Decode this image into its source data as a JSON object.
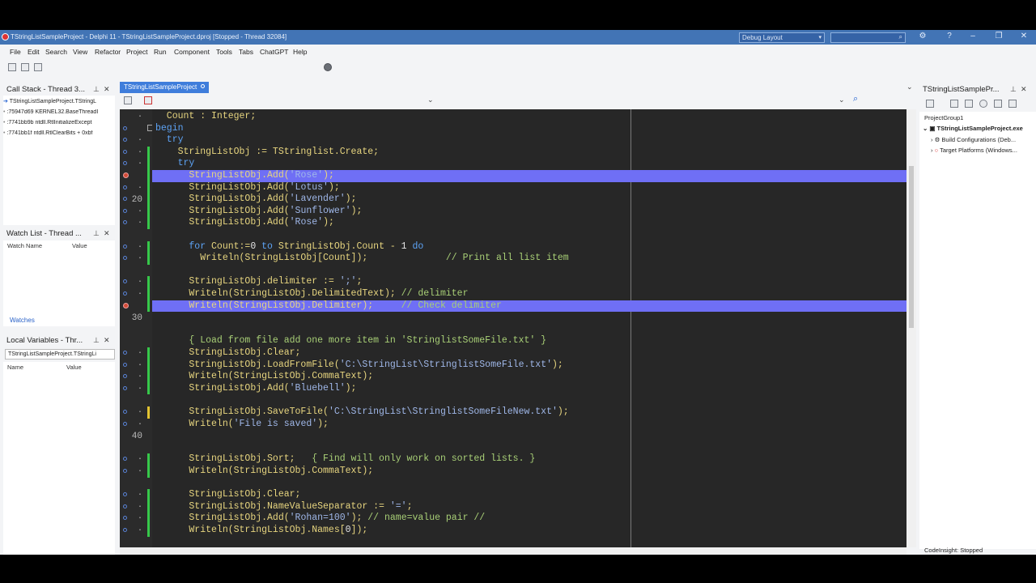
{
  "window": {
    "title": "TStringListSampleProject - Delphi 11 - TStringListSampleProject.dproj [Stopped - Thread 32084]",
    "layout": "Debug Layout"
  },
  "menu": [
    "File",
    "Edit",
    "Search",
    "View",
    "Refactor",
    "Project",
    "Run",
    "Component",
    "Tools",
    "Tabs",
    "ChatGPT",
    "Help"
  ],
  "call_stack": {
    "title": "Call Stack - Thread 3...",
    "rows": [
      "TStringListSampleProject.TStringL",
      ":75947d69 KERNEL32.BaseThreadI",
      ":7741bb9b ntdll.RtlInitializeExcept",
      ":7741bb1f ntdll.RtlClearBits + 0xbf"
    ]
  },
  "watch_list": {
    "title": "Watch List - Thread ...",
    "col_name": "Watch Name",
    "col_value": "Value",
    "tab": "Watches"
  },
  "local_vars": {
    "title": "Local Variables - Thr...",
    "selector": "TStringListSampleProject.TStringLi",
    "col_name": "Name",
    "col_value": "Value"
  },
  "editor": {
    "tab": "TStringListSampleProject",
    "gutter_numbers": {
      "20": "20",
      "30": "30",
      "40": "40"
    }
  },
  "code_lines": [
    [
      [
        "pl",
        "  Count : Integer;"
      ]
    ],
    [
      [
        "kw",
        "begin"
      ]
    ],
    [
      [
        "kw",
        "  try"
      ]
    ],
    [
      [
        "pl",
        "    StringListObj := TStringlist.Create;"
      ]
    ],
    [
      [
        "kw",
        "    try"
      ]
    ],
    [
      [
        "pl",
        "      StringListObj.Add("
      ],
      [
        "str",
        "'Rose'"
      ],
      [
        "pl",
        ");"
      ]
    ],
    [
      [
        "pl",
        "      StringListObj.Add("
      ],
      [
        "str",
        "'Lotus'"
      ],
      [
        "pl",
        ");"
      ]
    ],
    [
      [
        "pl",
        "      StringListObj.Add("
      ],
      [
        "str",
        "'Lavender'"
      ],
      [
        "pl",
        ");"
      ]
    ],
    [
      [
        "pl",
        "      StringListObj.Add("
      ],
      [
        "str",
        "'Sunflower'"
      ],
      [
        "pl",
        ");"
      ]
    ],
    [
      [
        "pl",
        "      StringListObj.Add("
      ],
      [
        "str",
        "'Rose'"
      ],
      [
        "pl",
        ");"
      ]
    ],
    [],
    [
      [
        "kw",
        "      for "
      ],
      [
        "pl",
        "Count:="
      ],
      [
        "num-c",
        "0"
      ],
      [
        "kw",
        " to "
      ],
      [
        "pl",
        "StringListObj.Count - "
      ],
      [
        "num-c",
        "1"
      ],
      [
        "kw",
        " do"
      ]
    ],
    [
      [
        "pl",
        "        Writeln(StringListObj[Count]);              "
      ],
      [
        "cm",
        "// Print all list item"
      ]
    ],
    [],
    [
      [
        "pl",
        "      StringListObj.delimiter := "
      ],
      [
        "str",
        "';'"
      ],
      [
        "pl",
        ";"
      ]
    ],
    [
      [
        "pl",
        "      Writeln(StringListObj.DelimitedText); "
      ],
      [
        "cm",
        "// delimiter"
      ]
    ],
    [
      [
        "pl",
        "      Writeln(StringListObj.Delimiter);     "
      ],
      [
        "cm",
        "// Check delimiter"
      ]
    ],
    [],
    [],
    [
      [
        "cm",
        "      { Load from file add one more item in 'StringlistSomeFile.txt' }"
      ]
    ],
    [
      [
        "pl",
        "      StringListObj.Clear;"
      ]
    ],
    [
      [
        "pl",
        "      StringListObj.LoadFromFile("
      ],
      [
        "str",
        "'C:\\StringList\\StringlistSomeFile.txt'"
      ],
      [
        "pl",
        ");"
      ]
    ],
    [
      [
        "pl",
        "      Writeln(StringListObj.CommaText);"
      ]
    ],
    [
      [
        "pl",
        "      StringListObj.Add("
      ],
      [
        "str",
        "'Bluebell'"
      ],
      [
        "pl",
        ");"
      ]
    ],
    [],
    [
      [
        "pl",
        "      StringListObj.SaveToFile("
      ],
      [
        "str",
        "'C:\\StringList\\StringlistSomeFileNew.txt'"
      ],
      [
        "pl",
        ");"
      ]
    ],
    [
      [
        "pl",
        "      Writeln("
      ],
      [
        "str",
        "'File is saved'"
      ],
      [
        "pl",
        ");"
      ]
    ],
    [],
    [],
    [
      [
        "pl",
        "      StringListObj.Sort;   "
      ],
      [
        "cm",
        "{ Find will only work on sorted lists. }"
      ]
    ],
    [
      [
        "pl",
        "      Writeln(StringListObj.CommaText);"
      ]
    ],
    [],
    [
      [
        "pl",
        "      StringListObj.Clear;"
      ]
    ],
    [
      [
        "pl",
        "      StringListObj.NameValueSeparator := "
      ],
      [
        "str",
        "'='"
      ],
      [
        "pl",
        ";"
      ]
    ],
    [
      [
        "pl",
        "      StringListObj.Add("
      ],
      [
        "str",
        "'Rohan=100'"
      ],
      [
        "pl",
        "); "
      ],
      [
        "cm",
        "// name=value pair //"
      ]
    ],
    [
      [
        "pl",
        "      Writeln(StringListObj.Names["
      ],
      [
        "num-c",
        "0"
      ],
      [
        "pl",
        "]);"
      ]
    ]
  ],
  "project": {
    "title": "TStringListSamplePr...",
    "group": "ProjectGroup1",
    "exe": "TStringListSampleProject.exe",
    "build": "Build Configurations (Deb...",
    "platforms": "Target Platforms (Windows..."
  },
  "status": "CodeInsight: Stopped"
}
